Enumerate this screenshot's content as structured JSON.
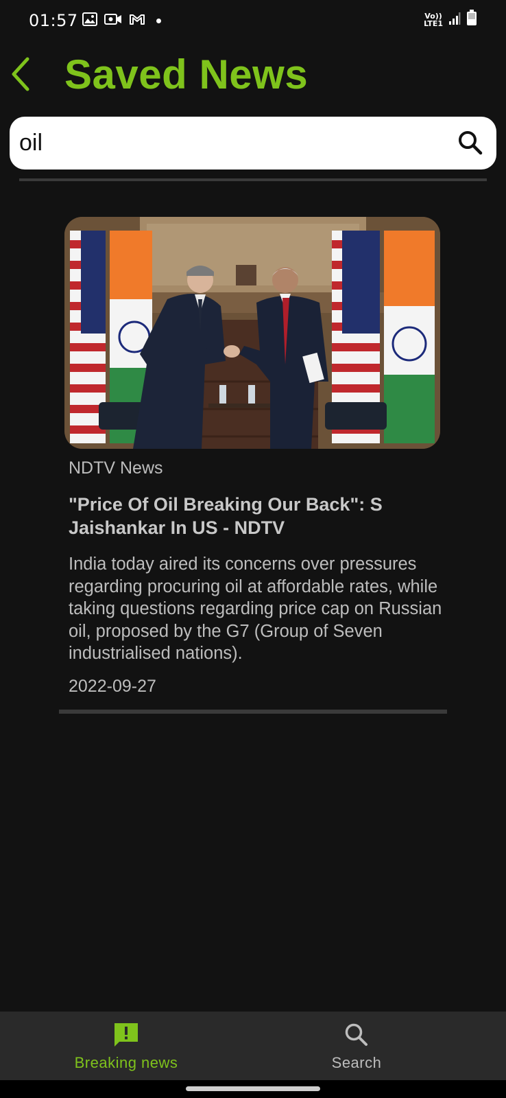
{
  "status_bar": {
    "time": "01:57",
    "network": "LTE1",
    "volte": "Vo))",
    "icons": [
      "gallery-icon",
      "video-call-icon",
      "gmail-icon",
      "notification-dot-icon",
      "signal-icon",
      "battery-icon"
    ]
  },
  "header": {
    "title": "Saved News",
    "back_icon": "chevron-left-icon"
  },
  "search": {
    "value": "oil",
    "placeholder": ""
  },
  "articles": [
    {
      "source": "NDTV News",
      "title": "\"Price Of Oil Breaking Our Back\": S Jaishankar In US - NDTV",
      "description": "India today aired its concerns over pressures regarding procuring oil at affordable rates, while taking questions regarding price cap on Russian oil, proposed by the G7 (Group of Seven industrialised nations).",
      "date": "2022-09-27"
    }
  ],
  "bottom_nav": {
    "items": [
      {
        "label": "Breaking news",
        "icon": "breaking-news-icon",
        "active": true
      },
      {
        "label": "Search",
        "icon": "search-icon",
        "active": false
      }
    ]
  },
  "colors": {
    "accent": "#7fc31c",
    "background": "#121212",
    "nav_background": "#2a2a2a",
    "inactive": "#bdbdbd"
  }
}
